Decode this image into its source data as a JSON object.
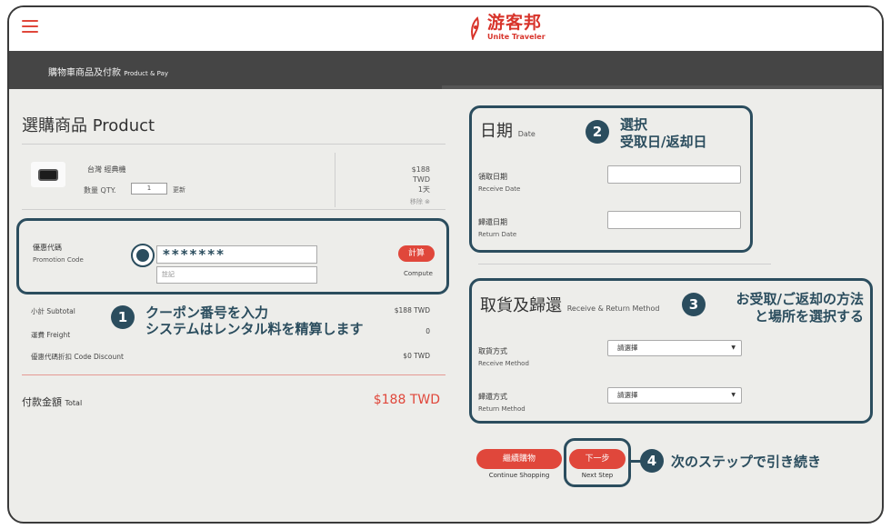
{
  "header": {
    "logo_cn": "游客邦",
    "logo_en": "Unite Traveler",
    "page_title_zh": "購物車商品及付款",
    "page_title_en": "Product & Pay"
  },
  "product": {
    "title_zh": "選購商品",
    "title_en": "Product",
    "name": "台灣 經典機",
    "qty_label": "數量 QTY.",
    "qty_value": "1",
    "update_label": "更新",
    "price": "$188",
    "currency": "TWD",
    "days": "1天",
    "remove_label": "移除"
  },
  "promo": {
    "label_zh": "優惠代碼",
    "label_en": "Promotion Code",
    "code_value": "*******",
    "note_placeholder": "註記",
    "compute_button": "計算",
    "compute_label": "Compute"
  },
  "summary": {
    "subtotal_label": "小計 Subtotal",
    "subtotal_value": "$188 TWD",
    "freight_label": "運費 Freight",
    "freight_value": "0",
    "discount_label": "優惠代碼折扣 Code Discount",
    "discount_value": "$0 TWD",
    "total_label_zh": "付款金額",
    "total_label_en": "Total",
    "total_value": "$188 TWD"
  },
  "date": {
    "title_zh": "日期",
    "title_en": "Date",
    "receive_zh": "領取日期",
    "receive_en": "Receive Date",
    "return_zh": "歸還日期",
    "return_en": "Return Date"
  },
  "method": {
    "title_zh": "取貨及歸還",
    "title_en": "Receive & Return Method",
    "receive_zh": "取貨方式",
    "receive_en": "Receive Method",
    "receive_select": "請選擇",
    "return_zh": "歸還方式",
    "return_en": "Return Method",
    "return_select": "請選擇"
  },
  "buttons": {
    "continue_zh": "繼續購物",
    "continue_en": "Continue Shopping",
    "next_zh": "下一步",
    "next_en": "Next Step"
  },
  "annotations": {
    "step1_num": "1",
    "step1_line1": "クーポン番号を入力",
    "step1_line2": "システムはレンタル料を精算します",
    "step2_num": "2",
    "step2_line1": "選択",
    "step2_line2": "受取日/返却日",
    "step3_num": "3",
    "step3_line1": "お受取/ご返却の方法",
    "step3_line2": "と場所を選択する",
    "step4_num": "4",
    "step4_text": "次のステップで引き続き"
  },
  "colors": {
    "accent": "#e0473b",
    "annotation": "#2b4d5e",
    "header_dark": "#454545"
  }
}
